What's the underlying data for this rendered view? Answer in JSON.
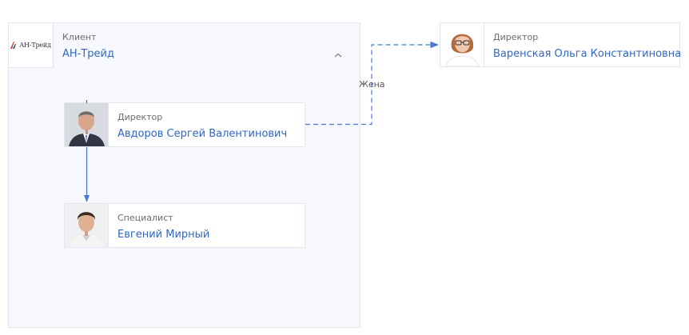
{
  "group": {
    "caption": "Клиент",
    "title": "АН-Трейд",
    "logo_text": "АН-Трейд"
  },
  "cards": [
    {
      "role": "Директор",
      "name": "Авдоров Сергей Валентинович"
    },
    {
      "role": "Специалист",
      "name": "Евгений Мирный"
    },
    {
      "role": "Директор",
      "name": "Варенская Ольга Константиновна"
    }
  ],
  "relation": {
    "label": "Жена"
  },
  "colors": {
    "link": "#2f66c4",
    "connector": "#4a78d4",
    "group_bg": "#f6f8fd",
    "border": "#e3e6ee"
  },
  "icons": {
    "collapse": "chevron-up-icon"
  }
}
